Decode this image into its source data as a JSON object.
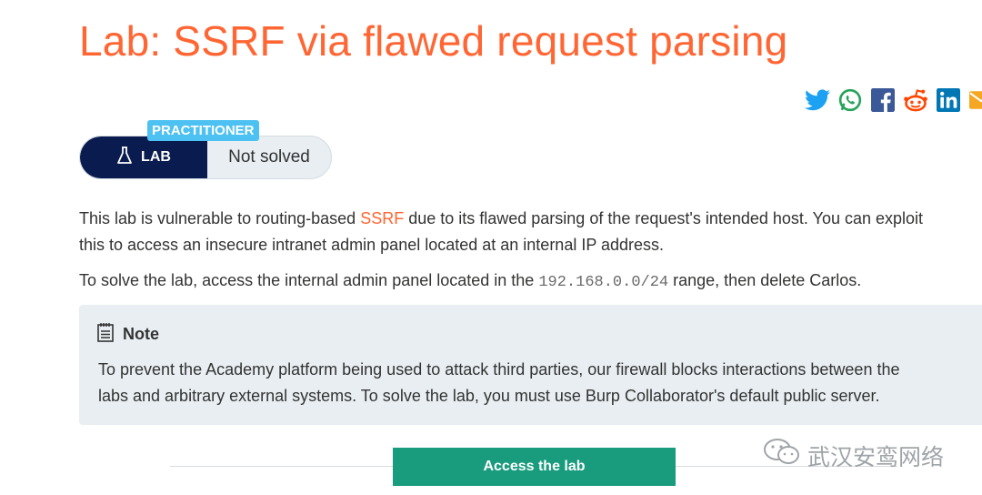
{
  "page": {
    "title": "Lab: SSRF via flawed request parsing"
  },
  "share": {
    "icons": [
      "twitter-icon",
      "whatsapp-icon",
      "facebook-icon",
      "reddit-icon",
      "linkedin-icon",
      "email-icon"
    ]
  },
  "lab_badge": {
    "level": "PRACTITIONER",
    "type_label": "LAB",
    "status": "Not solved"
  },
  "description": {
    "p1_before": "This lab is vulnerable to routing-based ",
    "p1_link": "SSRF",
    "p1_after": " due to its flawed parsing of the request's intended host. You can exploit",
    "p1_line2": "this to access an insecure intranet admin panel located at an internal IP address.",
    "p2_before": "To solve the lab, access the internal admin panel located in the ",
    "p2_code": "192.168.0.0/24",
    "p2_after": " range, then delete Carlos."
  },
  "note": {
    "heading": "Note",
    "line1": "To prevent the Academy platform being used to attack third parties, our firewall blocks interactions between the",
    "line2": "labs and arbitrary external systems. To solve the lab, you must use Burp Collaborator's default public server."
  },
  "actions": {
    "access_label": "Access the lab"
  },
  "watermark": {
    "text": "武汉安鸾网络"
  },
  "colors": {
    "accent": "#ff6633",
    "badge_blue": "#4cc1f2",
    "navy": "#0a1b4f",
    "note_bg": "#e8eef2",
    "button_green": "#199b7e"
  }
}
